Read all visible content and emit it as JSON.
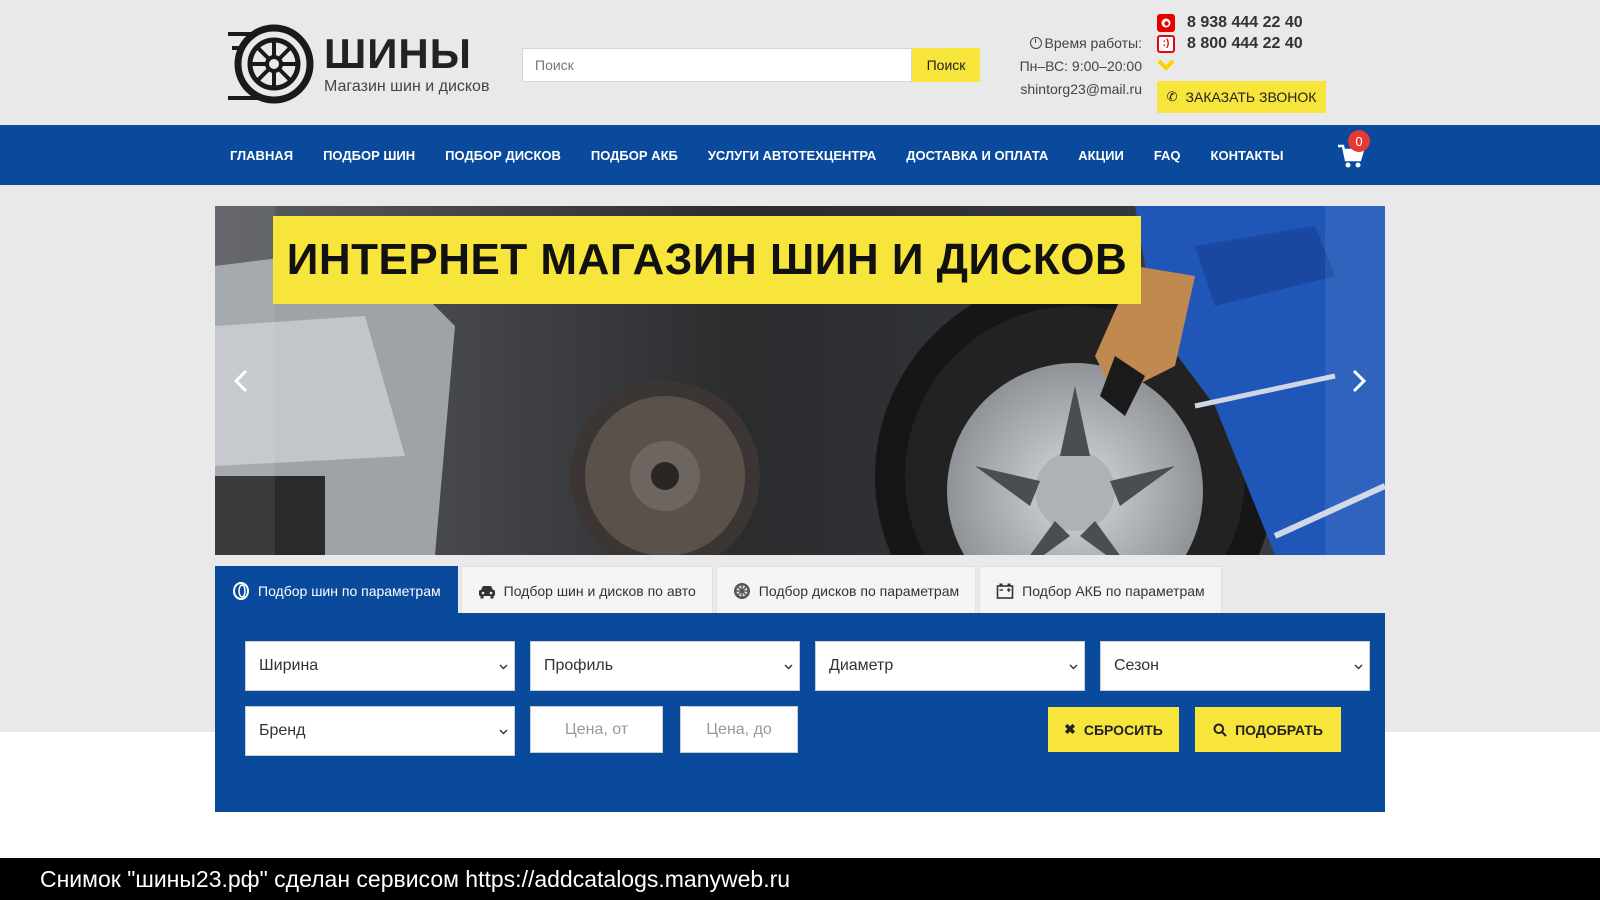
{
  "header": {
    "logo_title": "ШИНЫ",
    "logo_subtitle": "Магазин шин и дисков",
    "search_placeholder": "Поиск",
    "search_button": "Поиск",
    "hours_label": "Время работы:",
    "hours_value": "Пн–ВС: 9:00–20:00",
    "email": "shintorg23@mail.ru",
    "phones": [
      "8 938 444 22 40",
      "8 800 444 22 40"
    ],
    "callback_button": "ЗАКАЗАТЬ ЗВОНОК"
  },
  "nav": {
    "items": [
      "ГЛАВНАЯ",
      "ПОДБОР ШИН",
      "ПОДБОР ДИСКОВ",
      "ПОДБОР АКБ",
      "УСЛУГИ АВТОТЕХЦЕНТРА",
      "ДОСТАВКА И ОПЛАТА",
      "АКЦИИ",
      "FAQ",
      "КОНТАКТЫ"
    ],
    "cart_count": "0"
  },
  "banner": {
    "title": "ИНТЕРНЕТ МАГАЗИН ШИН И ДИСКОВ"
  },
  "tabs": [
    {
      "label": "Подбор шин по параметрам",
      "icon": "tire-icon",
      "active": true
    },
    {
      "label": "Подбор шин и дисков по авто",
      "icon": "car-icon",
      "active": false
    },
    {
      "label": "Подбор дисков по параметрам",
      "icon": "rim-icon",
      "active": false
    },
    {
      "label": "Подбор АКБ по параметрам",
      "icon": "battery-icon",
      "active": false
    }
  ],
  "filters": {
    "width": "Ширина",
    "profile": "Профиль",
    "diameter": "Диаметр",
    "season": "Сезон",
    "brand": "Бренд",
    "price_from": "Цена, от",
    "price_to": "Цена, до",
    "reset_button": "СБРОСИТЬ",
    "search_button": "ПОДОБРАТЬ"
  },
  "caption": "Снимок \"шины23.рф\" сделан сервисом https://addcatalogs.manyweb.ru",
  "colors": {
    "brand_blue": "#0a4a9c",
    "accent_yellow": "#f7e53b",
    "badge_red": "#e53935"
  }
}
